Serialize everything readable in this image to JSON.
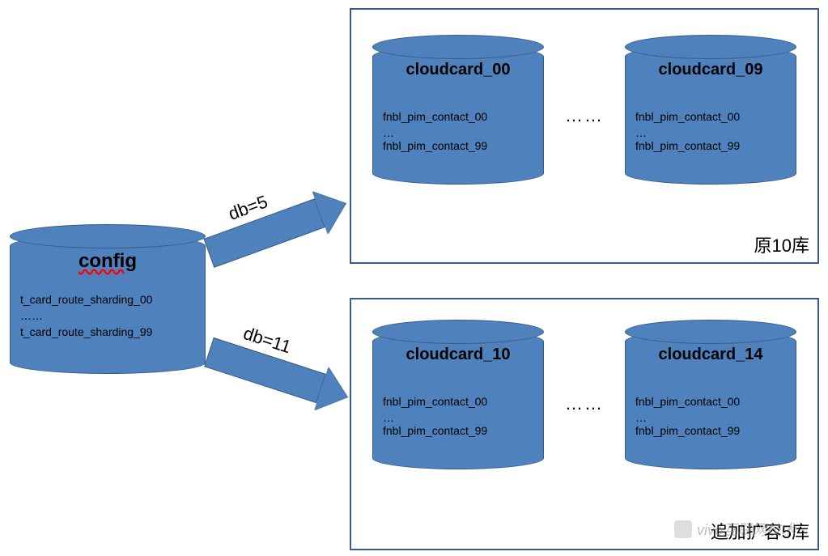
{
  "config_db": {
    "title": "config",
    "line1": "t_card_route_sharding_00",
    "dots": "……",
    "line2": "t_card_route_sharding_99"
  },
  "arrows": {
    "top_label": "db=5",
    "bottom_label": "db=11"
  },
  "top_box": {
    "label": "原10库",
    "db_left": {
      "title": "cloudcard_00",
      "line1": "fnbl_pim_contact_00",
      "dots": "…",
      "line2": "fnbl_pim_contact_99"
    },
    "dots": "……",
    "db_right": {
      "title": "cloudcard_09",
      "line1": "fnbl_pim_contact_00",
      "dots": "…",
      "line2": "fnbl_pim_contact_99"
    }
  },
  "bottom_box": {
    "label": "追加扩容5库",
    "db_left": {
      "title": "cloudcard_10",
      "line1": "fnbl_pim_contact_00",
      "dots": "…",
      "line2": "fnbl_pim_contact_99"
    },
    "dots": "……",
    "db_right": {
      "title": "cloudcard_14",
      "line1": "fnbl_pim_contact_00",
      "dots": "…",
      "line2": "fnbl_pim_contact_99"
    }
  },
  "watermark": "vivo互联网技术"
}
